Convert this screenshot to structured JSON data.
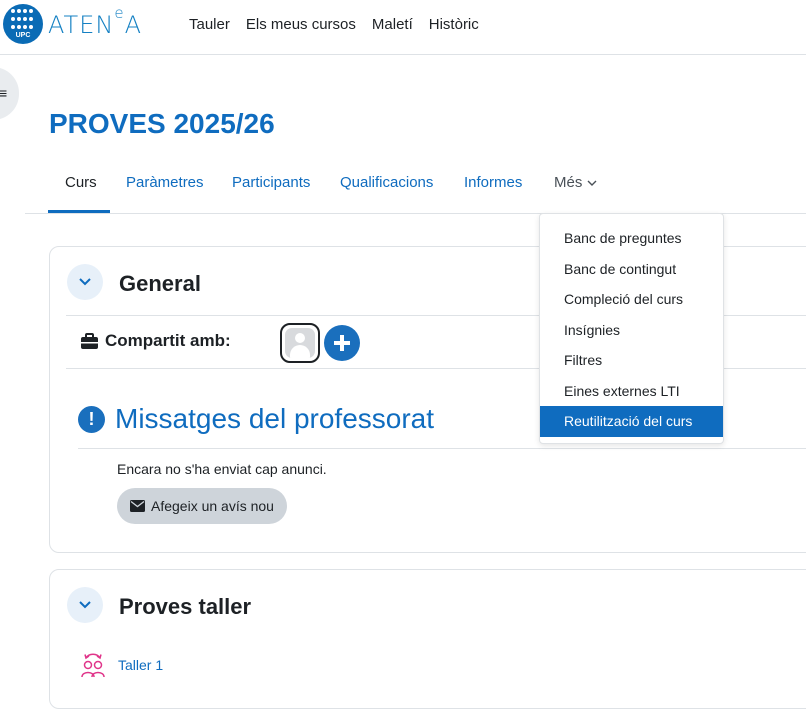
{
  "header": {
    "logo_text": "UPC",
    "brand_base": "ATEN",
    "brand_sup": "e",
    "brand_tail": "A",
    "nav": [
      "Tauler",
      "Els meus cursos",
      "Maletí",
      "Històric"
    ]
  },
  "course": {
    "title": "PROVES 2025/26",
    "tabs": [
      "Curs",
      "Paràmetres",
      "Participants",
      "Qualificacions",
      "Informes",
      "Més"
    ],
    "active_tab": "Curs"
  },
  "more_menu": {
    "items": [
      "Banc de preguntes",
      "Banc de contingut",
      "Compleció del curs",
      "Insígnies",
      "Filtres",
      "Eines externes LTI",
      "Reutilització del curs"
    ],
    "highlighted": "Reutilització del curs"
  },
  "general": {
    "title": "General",
    "shared_label": "Compartit amb:",
    "forum_title": "Missatges del professorat",
    "no_news": "Encara no s'ha enviat cap anunci.",
    "add_news_button": "Afegeix un avís nou"
  },
  "section2": {
    "title": "Proves taller",
    "activity": "Taller 1"
  },
  "colors": {
    "accent": "#0f6cbf",
    "highlight": "#0f6cbf",
    "workshop_icon": "#e0358a"
  },
  "icons": {
    "drawer": "hamburger-icon",
    "collapse": "chevron-down-icon",
    "shared": "briefcase-icon",
    "add": "plus-icon",
    "info": "exclamation-icon",
    "envelope": "envelope-icon",
    "workshop": "workshop-icon"
  }
}
